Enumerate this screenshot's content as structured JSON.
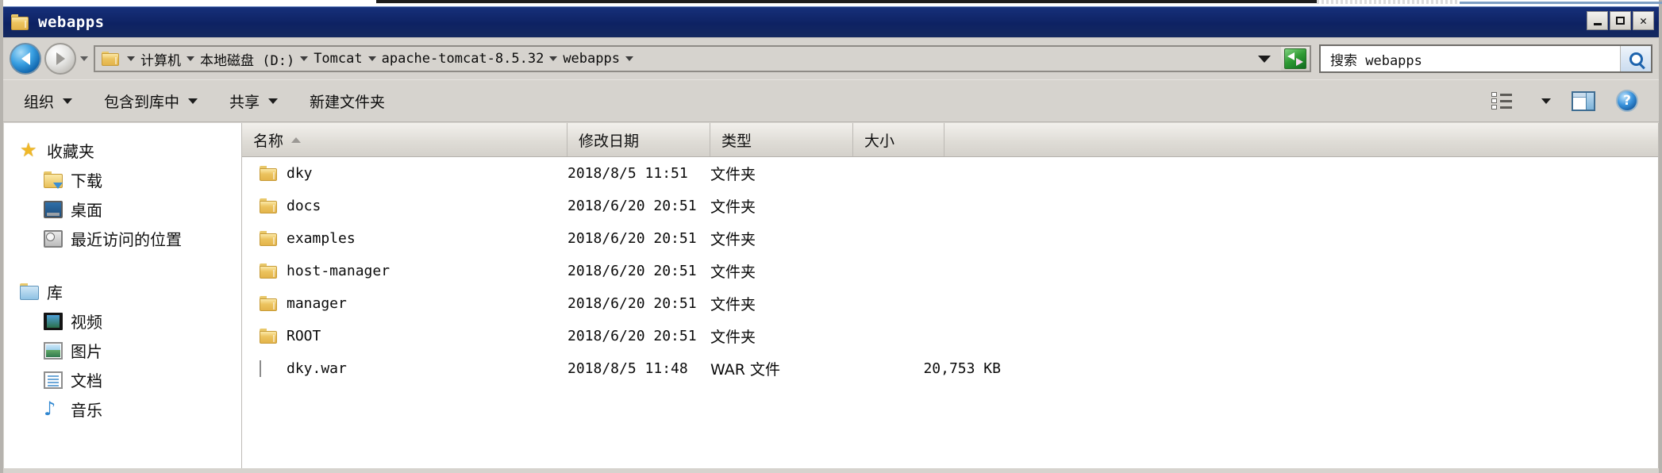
{
  "window": {
    "title": "webapps",
    "minimize_label": "最小化",
    "maximize_label": "最大化",
    "close_label": "关闭"
  },
  "address": {
    "breadcrumbs": [
      "计算机",
      "本地磁盘 (D:)",
      "Tomcat",
      "apache-tomcat-8.5.32",
      "webapps"
    ],
    "refresh_label": "刷新"
  },
  "search": {
    "value": "搜索 webapps",
    "placeholder": "搜索 webapps",
    "button_label": "搜索"
  },
  "toolbar": {
    "items": [
      {
        "label": "组织",
        "has_caret": true
      },
      {
        "label": "包含到库中",
        "has_caret": true
      },
      {
        "label": "共享",
        "has_caret": true
      },
      {
        "label": "新建文件夹",
        "has_caret": false
      }
    ],
    "view_label": "更改您的视图",
    "preview_label": "显示预览窗格",
    "help_label": "?"
  },
  "sidebar": {
    "groups": [
      {
        "label": "收藏夹",
        "icon": "star-icon",
        "children": [
          {
            "label": "下载",
            "icon": "download-folder-icon"
          },
          {
            "label": "桌面",
            "icon": "desktop-icon"
          },
          {
            "label": "最近访问的位置",
            "icon": "recent-places-icon"
          }
        ]
      },
      {
        "label": "库",
        "icon": "library-icon",
        "children": [
          {
            "label": "视频",
            "icon": "video-icon"
          },
          {
            "label": "图片",
            "icon": "picture-icon"
          },
          {
            "label": "文档",
            "icon": "document-icon"
          },
          {
            "label": "音乐",
            "icon": "music-icon"
          }
        ]
      }
    ]
  },
  "filelist": {
    "columns": [
      {
        "label": "名称",
        "sorted": "asc"
      },
      {
        "label": "修改日期",
        "sorted": ""
      },
      {
        "label": "类型",
        "sorted": ""
      },
      {
        "label": "大小",
        "sorted": ""
      }
    ],
    "rows": [
      {
        "icon": "folder-icon",
        "name": "dky",
        "date": "2018/8/5 11:51",
        "type": "文件夹",
        "size": ""
      },
      {
        "icon": "folder-icon",
        "name": "docs",
        "date": "2018/6/20 20:51",
        "type": "文件夹",
        "size": ""
      },
      {
        "icon": "folder-icon",
        "name": "examples",
        "date": "2018/6/20 20:51",
        "type": "文件夹",
        "size": ""
      },
      {
        "icon": "folder-icon",
        "name": "host-manager",
        "date": "2018/6/20 20:51",
        "type": "文件夹",
        "size": ""
      },
      {
        "icon": "folder-icon",
        "name": "manager",
        "date": "2018/6/20 20:51",
        "type": "文件夹",
        "size": ""
      },
      {
        "icon": "folder-icon",
        "name": "ROOT",
        "date": "2018/6/20 20:51",
        "type": "文件夹",
        "size": ""
      },
      {
        "icon": "war-icon",
        "name": "dky.war",
        "date": "2018/8/5 11:48",
        "type": "WAR 文件",
        "size": "20,753 KB"
      }
    ]
  },
  "colors": {
    "titlebar": "#12286d",
    "chrome": "#d6d3ce",
    "pane": "#ffffff",
    "folder": "#ecc35e"
  }
}
